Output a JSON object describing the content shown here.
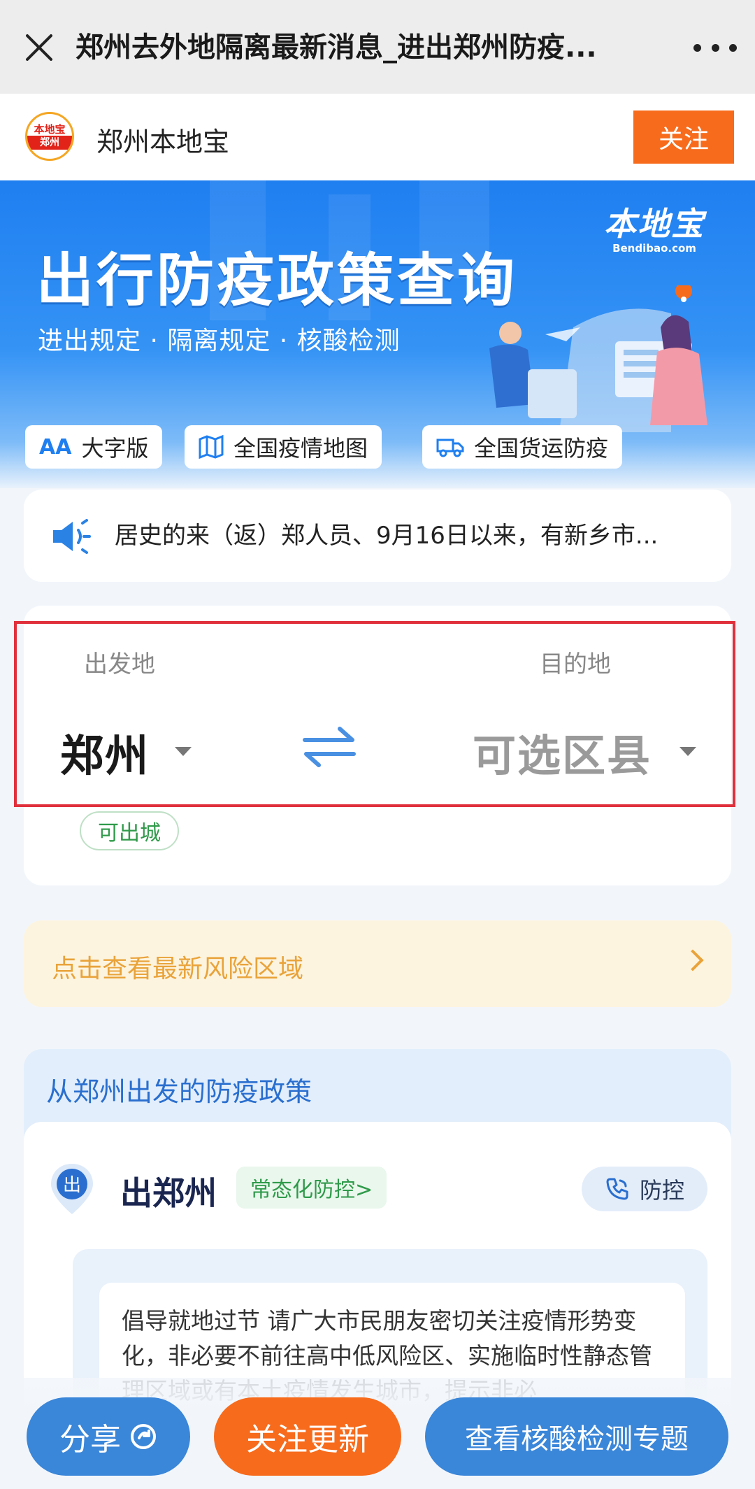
{
  "header": {
    "title": "郑州去外地隔离最新消息_进出郑州防疫..."
  },
  "account": {
    "logo_top": "本地宝",
    "logo_bottom": "郑州",
    "name": "郑州本地宝",
    "follow_label": "关注"
  },
  "banner": {
    "brand_cn": "本地宝",
    "brand_en": "Bendibao.com",
    "title": "出行防疫政策查询",
    "subtitle": "进出规定 · 隔离规定 · 核酸检测",
    "chips": [
      {
        "icon": "AA",
        "label": "大字版"
      },
      {
        "icon": "map",
        "label": "全国疫情地图"
      },
      {
        "icon": "truck",
        "label": "全国货运防疫"
      }
    ]
  },
  "notice": {
    "text": "居史的来（返）郑人员、9月16日以来，有新乡市..."
  },
  "route": {
    "from_label": "出发地",
    "to_label": "目的地",
    "from_city": "郑州",
    "to_city": "可选区县",
    "status": "可出城"
  },
  "risk": {
    "text": "点击查看最新风险区域"
  },
  "policy": {
    "heading": "从郑州出发的防疫政策",
    "pin_label": "出",
    "title": "出郑州",
    "tag": "常态化防控>",
    "control_label": "防控",
    "body": "倡导就地过节 请广大市民朋友密切关注疫情形势变化，非必要不前往高中低风险区、实施临时性静态管理区域或有本土疫情发生城市，提示非必"
  },
  "bottom": {
    "share": "分享",
    "follow": "关注更新",
    "nat": "查看核酸检测专题"
  },
  "colors": {
    "accent_blue": "#1f7ff0",
    "orange": "#f76b1c",
    "red_frame": "#e0303c",
    "green": "#2f9a4a"
  }
}
